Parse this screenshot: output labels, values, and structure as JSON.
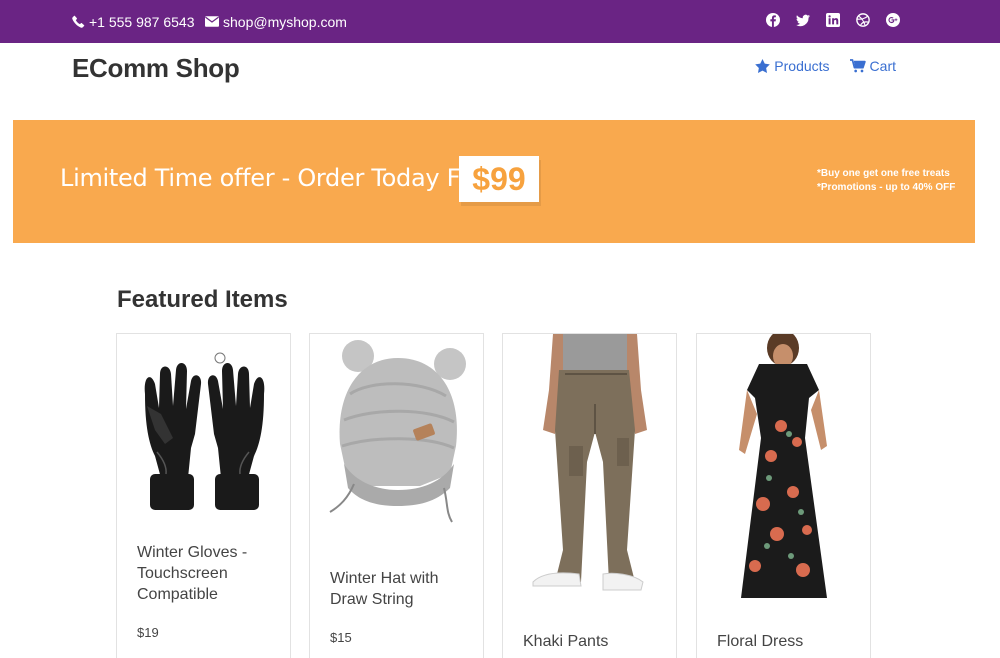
{
  "topbar": {
    "phone": "+1 555 987 6543",
    "email": "shop@myshop.com",
    "phone_icon": "phone-icon",
    "email_icon": "envelope-icon",
    "socials": [
      "facebook-icon",
      "twitter-icon",
      "linkedin-icon",
      "dribbble-icon",
      "google-plus-icon"
    ],
    "background": "#6a2484"
  },
  "header": {
    "logo": "EComm Shop",
    "nav": [
      {
        "label": "Products",
        "icon": "star-icon"
      },
      {
        "label": "Cart",
        "icon": "cart-icon"
      }
    ],
    "link_color": "#3a6fd1"
  },
  "banner": {
    "headline": "Limited Time offer - Order Today For",
    "price": "$99",
    "notes": [
      "*Buy one get one free treats",
      "*Promotions - up to 40% OFF"
    ],
    "background": "#f9a94e"
  },
  "featured": {
    "title": "Featured Items",
    "products": [
      {
        "name": "Winter Gloves - Touchscreen Compatible",
        "price": "$19",
        "image": "gloves-image"
      },
      {
        "name": "Winter Hat with Draw String",
        "price": "$15",
        "image": "hat-image"
      },
      {
        "name": "Khaki Pants",
        "price": "",
        "image": "pants-image"
      },
      {
        "name": "Floral Dress",
        "price": "",
        "image": "dress-image"
      }
    ]
  }
}
